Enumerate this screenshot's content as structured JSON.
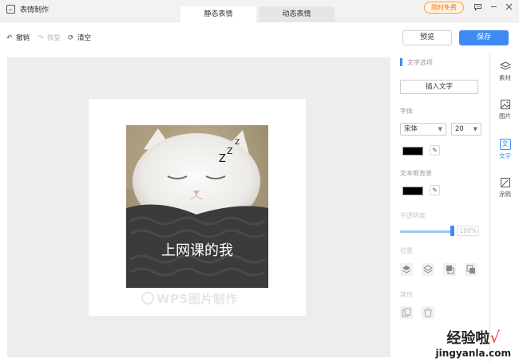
{
  "titlebar": {
    "app_title": "表情制作",
    "tabs": [
      {
        "label": "静态表情",
        "active": true
      },
      {
        "label": "动态表情",
        "active": false
      }
    ],
    "vip_badge": "限时免费"
  },
  "toolbar": {
    "undo": "撤销",
    "redo": "恢复",
    "clear": "清空",
    "preview": "预览",
    "save": "保存"
  },
  "canvas": {
    "caption": "上网课的我",
    "zzz": "z z z",
    "watermark": "WPS图片制作"
  },
  "panel": {
    "section_title": "文字选项",
    "insert_text": "插入文字",
    "font_label": "字体",
    "font_value": "宋体",
    "size_value": "20",
    "bg_label": "文本框背景",
    "opacity_label": "不透明度",
    "opacity_value": "100%",
    "position_label": "位置",
    "other_label": "其他"
  },
  "rail": {
    "items": [
      {
        "label": "素材",
        "icon": "layers-icon"
      },
      {
        "label": "图片",
        "icon": "image-icon"
      },
      {
        "label": "文字",
        "icon": "text-icon",
        "glyph": "文",
        "active": true
      },
      {
        "label": "涂鸦",
        "icon": "brush-icon"
      }
    ]
  },
  "site_watermark": {
    "line1": "经验啦",
    "check": "√",
    "line2": "jingyanla.com"
  },
  "colors": {
    "accent": "#3d8bf2",
    "text_color": "#000000",
    "text_bg": "#000000",
    "vip": "#e8781a"
  }
}
